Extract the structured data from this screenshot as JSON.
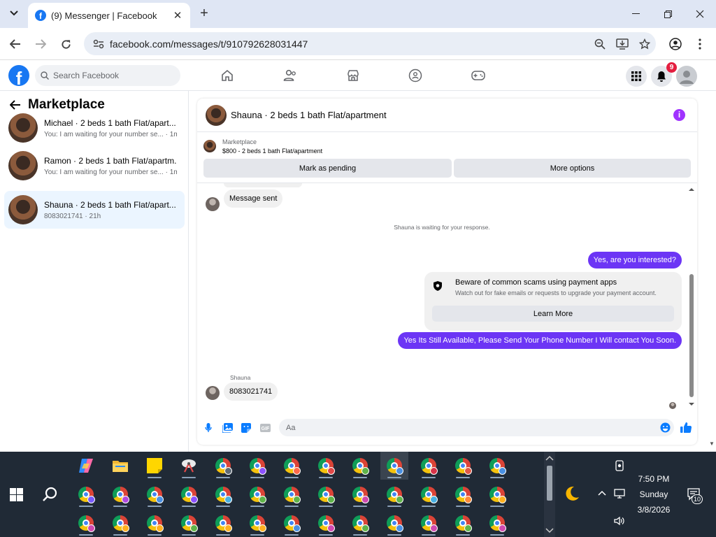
{
  "browser": {
    "tab_title": "(9) Messenger | Facebook",
    "url": "facebook.com/messages/t/910792628031447"
  },
  "facebook": {
    "search_placeholder": "Search Facebook",
    "notification_count": "9"
  },
  "sidebar": {
    "title": "Marketplace",
    "conversations": [
      {
        "name": "Michael · 2 beds 1 bath Flat/apart...",
        "preview": "You: I am waiting for your number se... · 1m"
      },
      {
        "name": "Ramon · 2 beds 1 bath Flat/apartm...",
        "preview": "You: I am waiting for your number se... · 1m"
      },
      {
        "name": "Shauna · 2 beds 1 bath Flat/apart...",
        "preview": "8083021741 · 21h"
      }
    ]
  },
  "chat": {
    "header_name": "Shauna · 2 beds 1 bath Flat/apartment",
    "marketplace_label": "Marketplace",
    "listing": "$800 - 2 beds 1 bath Flat/apartment",
    "mark_pending": "Mark as pending",
    "more_options": "More options",
    "messages": {
      "msg_sent": "Message sent",
      "waiting": "Shauna is waiting for your response.",
      "out1": "Yes, are you interested?",
      "warn_title": "Beware of common scams using payment apps",
      "warn_body": "Watch out for fake emails or requests to upgrade your payment account.",
      "learn_more": "Learn More",
      "out2": "Yes Its Still Available, Please Send Your Phone Number I Will contact You Soon.",
      "sender": "Shauna",
      "in_last": "8083021741"
    },
    "composer_placeholder": "Aa"
  },
  "taskbar": {
    "time": "7:50 PM",
    "day": "Sunday",
    "date": "3/8/2026",
    "notification_count": "10"
  }
}
